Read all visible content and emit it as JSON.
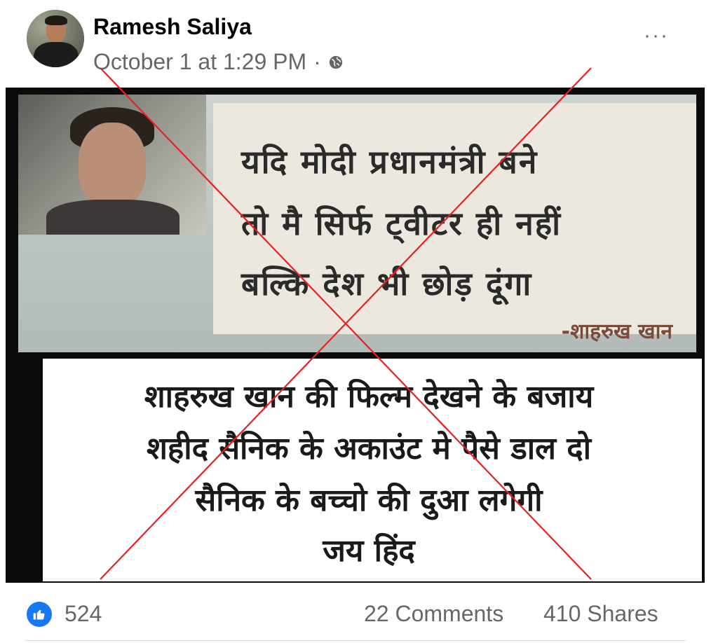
{
  "post": {
    "author": "Ramesh Saliya",
    "timestamp": "October 1 at 1:29 PM",
    "separator": "·",
    "privacy_icon": "globe-icon",
    "more_icon": "more-options-icon",
    "more_label": "···"
  },
  "image": {
    "quote_lines": [
      "यदि मोदी प्रधानमंत्री बने",
      "तो मै सिर्फ ट्वीटर ही नहीं",
      "बल्कि देश भी छोड़ दूंगा"
    ],
    "quote_attribution": "-शाहरुख खान",
    "message_lines": [
      "शाहरुख खान की फिल्म देखने के बजाय",
      "शहीद सैनिक के अकाउंट मे पैसे डाल दो",
      "सैनिक के बच्चो की दुआ लगेगी",
      "जय हिंद"
    ],
    "cross_color": "#e8201f"
  },
  "reactions": {
    "like_count": "524",
    "comments": "22 Comments",
    "shares": "410 Shares",
    "like_color": "#1877f2"
  }
}
